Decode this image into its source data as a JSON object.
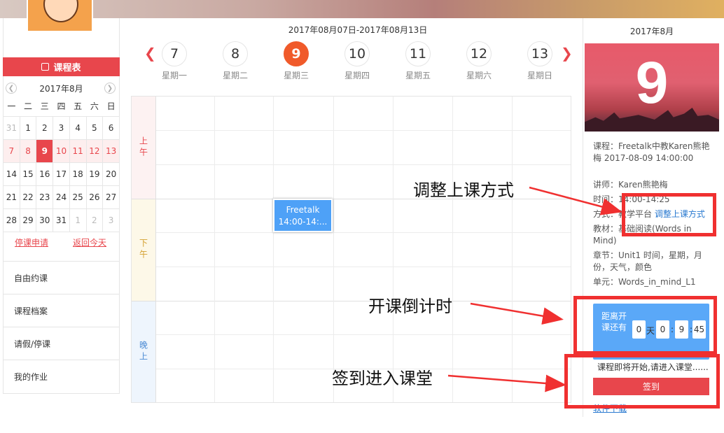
{
  "sidebar": {
    "course_table_label": "课程表",
    "calendar_month": "2017年8月",
    "weekdays": [
      "一",
      "二",
      "三",
      "四",
      "五",
      "六",
      "日"
    ],
    "weeks": [
      [
        "31",
        "1",
        "2",
        "3",
        "4",
        "5",
        "6"
      ],
      [
        "7",
        "8",
        "9",
        "10",
        "11",
        "12",
        "13"
      ],
      [
        "14",
        "15",
        "16",
        "17",
        "18",
        "19",
        "20"
      ],
      [
        "21",
        "22",
        "23",
        "24",
        "25",
        "26",
        "27"
      ],
      [
        "28",
        "29",
        "30",
        "31",
        "1",
        "2",
        "3"
      ]
    ],
    "suspend_link": "停课申请",
    "today_link": "返回今天",
    "menu": [
      "自由约课",
      "课程档案",
      "请假/停课",
      "我的作业"
    ]
  },
  "week": {
    "range": "2017年08月07日-2017年08月13日",
    "days": [
      {
        "num": "7",
        "label": "星期一"
      },
      {
        "num": "8",
        "label": "星期二"
      },
      {
        "num": "9",
        "label": "星期三"
      },
      {
        "num": "10",
        "label": "星期四"
      },
      {
        "num": "11",
        "label": "星期五"
      },
      {
        "num": "12",
        "label": "星期六"
      },
      {
        "num": "13",
        "label": "星期日"
      }
    ],
    "periods": [
      "上午",
      "下午",
      "晚上"
    ],
    "event": {
      "title": "Freetalk",
      "time": "14:00-14:..."
    }
  },
  "detail": {
    "month": "2017年8月",
    "day": "9",
    "course_key": "课程：",
    "course_val": "Freetalk中教Karen熊艳梅 2017-08-09 14:00:00",
    "teacher_key": "讲师：",
    "teacher_val": "Karen熊艳梅",
    "time_key": "时间：",
    "time_val": "14:00-14:25",
    "method_key": "方式：",
    "method_val": "教学平台",
    "method_link": "调整上课方式",
    "material_key": "教材：",
    "material_val": "基础阅读(Words in Mind)",
    "chapter_key": "章节：",
    "chapter_val": "Unit1 时间，星期，月份，天气，颜色",
    "unit_key": "单元：",
    "unit_val": "Words_in_mind_L1",
    "countdown_label": "距离开课还有",
    "countdown": {
      "days": "0",
      "day_unit": "天",
      "h": "0",
      "m": "9",
      "s": "45"
    },
    "ready_text": "课程即将开始,请进入课堂......",
    "signin_label": "签到",
    "download_partial": "软件下载"
  },
  "annotations": {
    "adjust": "调整上课方式",
    "countdown": "开课倒计时",
    "signin": "签到进入课堂",
    "color": "#f03030"
  }
}
